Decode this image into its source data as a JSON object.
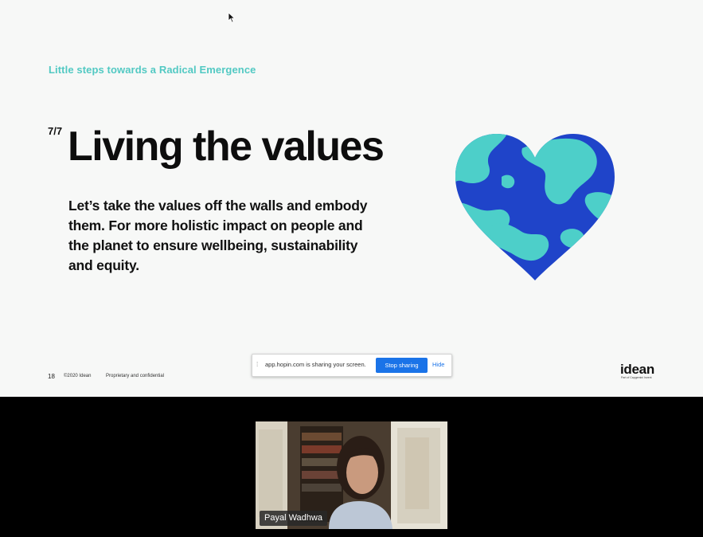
{
  "slide": {
    "kicker": "Little steps towards a Radical Emergence",
    "step": "7/7",
    "title": "Living the values",
    "body_lines": [
      "Let’s take the values off the walls and embody",
      "them. For more holistic impact on people and",
      "the planet to ensure wellbeing, sustainability",
      "and equity."
    ],
    "page_number": "18",
    "copyright": "©2020 Idean",
    "confidential": "Proprietary and confidential",
    "brand": "idean",
    "brand_sub": "Part of Capgemini Invent",
    "colors": {
      "kicker": "#52c9c3",
      "heart_teal": "#4dcfc9",
      "heart_blue": "#1f44c9"
    },
    "illustration": "heart-globe-icon"
  },
  "share_bar": {
    "message": "app.hopin.com is sharing your screen.",
    "stop_label": "Stop sharing",
    "hide_label": "Hide",
    "accent": "#1a73e8"
  },
  "video": {
    "participant_name": "Payal Wadhwa"
  }
}
